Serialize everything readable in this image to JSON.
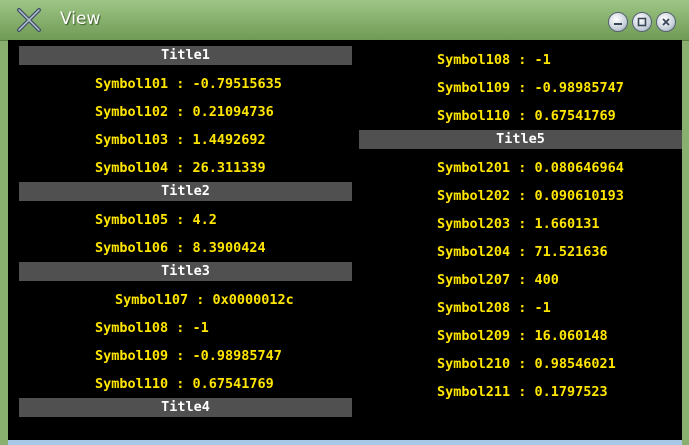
{
  "window": {
    "title": "View"
  },
  "left": [
    {
      "type": "header",
      "text": "Title1"
    },
    {
      "type": "row",
      "text": "Symbol101 : -0.79515635"
    },
    {
      "type": "row",
      "text": "Symbol102 : 0.21094736"
    },
    {
      "type": "row",
      "text": "Symbol103 : 1.4492692"
    },
    {
      "type": "row",
      "text": "Symbol104 : 26.311339"
    },
    {
      "type": "header",
      "text": "Title2"
    },
    {
      "type": "row",
      "text": "Symbol105 : 4.2"
    },
    {
      "type": "row",
      "text": "Symbol106 : 8.3900424"
    },
    {
      "type": "header",
      "text": "Title3"
    },
    {
      "type": "row",
      "text": "Symbol107 : 0x0000012c",
      "indent": true
    },
    {
      "type": "row",
      "text": "Symbol108 : -1"
    },
    {
      "type": "row",
      "text": "Symbol109 : -0.98985747"
    },
    {
      "type": "row",
      "text": "Symbol110 : 0.67541769"
    },
    {
      "type": "header",
      "text": "Title4"
    }
  ],
  "right": [
    {
      "type": "row",
      "text": "Symbol108 : -1"
    },
    {
      "type": "row",
      "text": "Symbol109 : -0.98985747"
    },
    {
      "type": "row",
      "text": "Symbol110 : 0.67541769"
    },
    {
      "type": "header",
      "text": "Title5"
    },
    {
      "type": "row",
      "text": "Symbol201 : 0.080646964"
    },
    {
      "type": "row",
      "text": "Symbol202 : 0.090610193"
    },
    {
      "type": "row",
      "text": "Symbol203 : 1.660131"
    },
    {
      "type": "row",
      "text": "Symbol204 : 71.521636"
    },
    {
      "type": "row",
      "text": "Symbol207 : 400"
    },
    {
      "type": "row",
      "text": "Symbol208 : -1"
    },
    {
      "type": "row",
      "text": "Symbol209 : 16.060148"
    },
    {
      "type": "row",
      "text": "Symbol210 : 0.98546021"
    },
    {
      "type": "row",
      "text": "Symbol211 : 0.1797523"
    }
  ]
}
